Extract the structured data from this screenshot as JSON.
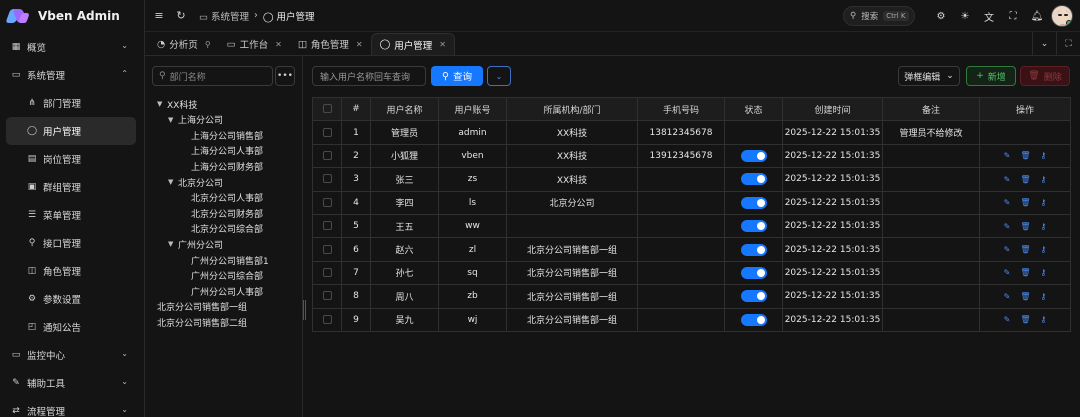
{
  "app": {
    "title": "Vben Admin"
  },
  "sidebar": {
    "items": [
      {
        "label": "概览",
        "icon": "grid-icon",
        "glyph": "▦",
        "expandable": true,
        "expanded": false,
        "level": 0
      },
      {
        "label": "系统管理",
        "icon": "monitor-icon",
        "glyph": "▭",
        "expandable": true,
        "expanded": true,
        "level": 0
      },
      {
        "label": "部门管理",
        "icon": "org-icon",
        "glyph": "⋔",
        "level": 1
      },
      {
        "label": "用户管理",
        "icon": "user-icon",
        "glyph": "◯",
        "level": 1,
        "active": true
      },
      {
        "label": "岗位管理",
        "icon": "post-icon",
        "glyph": "▤",
        "level": 1
      },
      {
        "label": "群组管理",
        "icon": "group-icon",
        "glyph": "▣",
        "level": 1
      },
      {
        "label": "菜单管理",
        "icon": "menu-icon",
        "glyph": "☰",
        "level": 1
      },
      {
        "label": "接口管理",
        "icon": "api-icon",
        "glyph": "⚲",
        "level": 1
      },
      {
        "label": "角色管理",
        "icon": "role-icon",
        "glyph": "◫",
        "level": 1
      },
      {
        "label": "参数设置",
        "icon": "settings-icon",
        "glyph": "⚙",
        "level": 1
      },
      {
        "label": "通知公告",
        "icon": "notice-icon",
        "glyph": "◰",
        "level": 1
      },
      {
        "label": "监控中心",
        "icon": "monitor-center-icon",
        "glyph": "▭",
        "expandable": true,
        "expanded": false,
        "level": 0
      },
      {
        "label": "辅助工具",
        "icon": "tool-icon",
        "glyph": "✎",
        "expandable": true,
        "expanded": false,
        "level": 0
      },
      {
        "label": "流程管理",
        "icon": "flow-icon",
        "glyph": "⇄",
        "expandable": true,
        "expanded": false,
        "level": 0
      }
    ]
  },
  "header": {
    "breadcrumb": [
      {
        "label": "系统管理"
      },
      {
        "label": "用户管理"
      }
    ],
    "search": {
      "label": "搜索",
      "shortcut": "Ctrl K"
    }
  },
  "tabs": [
    {
      "label": "分析页",
      "icon": "analysis-icon",
      "glyph": "◔",
      "pinned": true
    },
    {
      "label": "工作台",
      "icon": "desk-icon",
      "glyph": "▭",
      "closable": true
    },
    {
      "label": "角色管理",
      "icon": "role-icon",
      "glyph": "◫",
      "closable": true
    },
    {
      "label": "用户管理",
      "icon": "user-icon",
      "glyph": "◯",
      "closable": true,
      "active": true
    }
  ],
  "tree": {
    "search_placeholder": "部门名称",
    "nodes": [
      {
        "label": "XX科技",
        "level": 0,
        "caret": true
      },
      {
        "label": "上海分公司",
        "level": 1,
        "caret": true
      },
      {
        "label": "上海分公司销售部",
        "level": 2
      },
      {
        "label": "上海分公司人事部",
        "level": 2
      },
      {
        "label": "上海分公司财务部",
        "level": 2
      },
      {
        "label": "北京分公司",
        "level": 1,
        "caret": true
      },
      {
        "label": "北京分公司人事部",
        "level": 2
      },
      {
        "label": "北京分公司财务部",
        "level": 2
      },
      {
        "label": "北京分公司综合部",
        "level": 2
      },
      {
        "label": "广州分公司",
        "level": 1,
        "caret": true
      },
      {
        "label": "广州分公司销售部1",
        "level": 2
      },
      {
        "label": "广州分公司综合部",
        "level": 2
      },
      {
        "label": "广州分公司人事部",
        "level": 2
      },
      {
        "label": "北京分公司销售部一组",
        "level": 0
      },
      {
        "label": "北京分公司销售部二组",
        "level": 0
      }
    ]
  },
  "toolbar": {
    "search_placeholder": "输入用户名称回车查询",
    "query_label": "查询",
    "mode_label": "弹框编辑",
    "add_label": "新增",
    "delete_label": "删除"
  },
  "table": {
    "columns": [
      "#",
      "用户名称",
      "用户账号",
      "所属机构/部门",
      "手机号码",
      "状态",
      "创建时间",
      "备注",
      "操作"
    ],
    "rows": [
      {
        "no": "1",
        "name": "管理员",
        "account": "admin",
        "dept": "XX科技",
        "phone": "13812345678",
        "status": null,
        "created": "2025-12-22 15:01:35",
        "remark": "管理员不给修改",
        "link": false
      },
      {
        "no": "2",
        "name": "小狐狸",
        "account": "vben",
        "dept": "XX科技",
        "phone": "13912345678",
        "status": true,
        "created": "2025-12-22 15:01:35",
        "remark": "",
        "link": true
      },
      {
        "no": "3",
        "name": "张三",
        "account": "zs",
        "dept": "XX科技",
        "phone": "",
        "status": true,
        "created": "2025-12-22 15:01:35",
        "remark": "",
        "link": true
      },
      {
        "no": "4",
        "name": "李四",
        "account": "ls",
        "dept": "北京分公司",
        "phone": "",
        "status": true,
        "created": "2025-12-22 15:01:35",
        "remark": "",
        "link": true
      },
      {
        "no": "5",
        "name": "王五",
        "account": "ww",
        "dept": "",
        "phone": "",
        "status": true,
        "created": "2025-12-22 15:01:35",
        "remark": "",
        "link": true
      },
      {
        "no": "6",
        "name": "赵六",
        "account": "zl",
        "dept": "北京分公司销售部一组",
        "phone": "",
        "status": true,
        "created": "2025-12-22 15:01:35",
        "remark": "",
        "link": true
      },
      {
        "no": "7",
        "name": "孙七",
        "account": "sq",
        "dept": "北京分公司销售部一组",
        "phone": "",
        "status": true,
        "created": "2025-12-22 15:01:35",
        "remark": "",
        "link": true
      },
      {
        "no": "8",
        "name": "周八",
        "account": "zb",
        "dept": "北京分公司销售部一组",
        "phone": "",
        "status": true,
        "created": "2025-12-22 15:01:35",
        "remark": "",
        "link": true
      },
      {
        "no": "9",
        "name": "吴九",
        "account": "wj",
        "dept": "北京分公司销售部一组",
        "phone": "",
        "status": true,
        "created": "2025-12-22 15:01:35",
        "remark": "",
        "link": true
      }
    ]
  },
  "colors": {
    "accent": "#1677ff",
    "success": "#58c26b",
    "danger": "#8b3a3e",
    "background": "#141414"
  }
}
